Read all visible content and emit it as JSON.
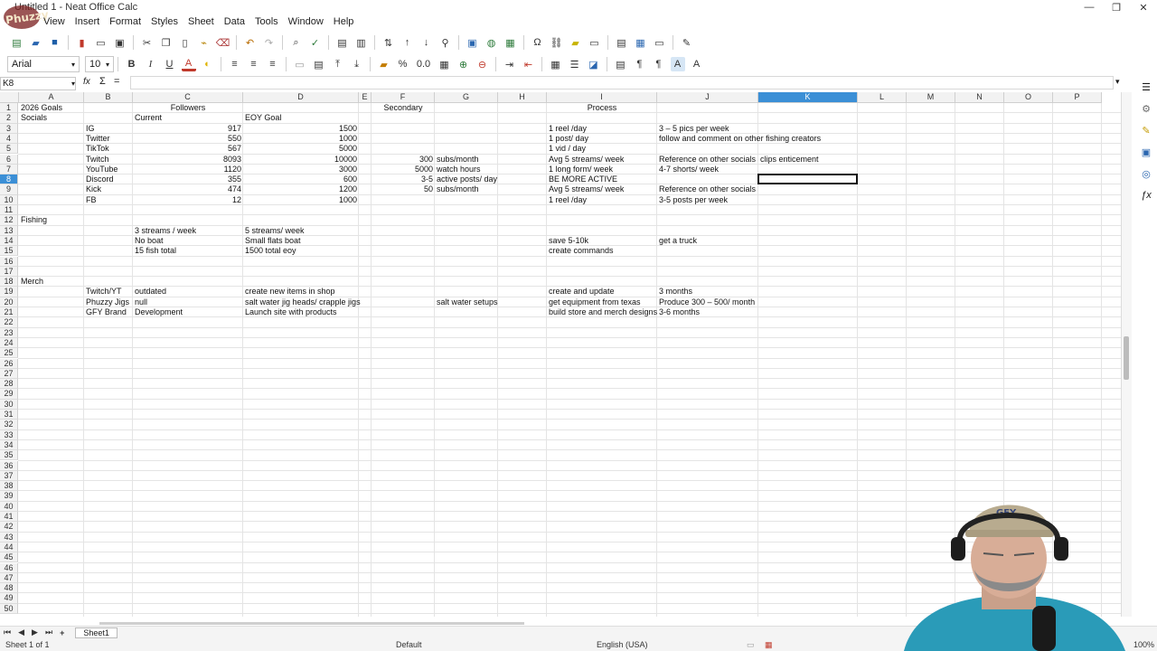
{
  "window": {
    "title": "Untitled 1 - Neat Office Calc",
    "controls": [
      "—",
      "❐",
      "✕"
    ]
  },
  "menu": [
    "View",
    "Insert",
    "Format",
    "Styles",
    "Sheet",
    "Data",
    "Tools",
    "Window",
    "Help"
  ],
  "format_toolbar": {
    "font_name": "Arial",
    "font_size": "10",
    "bold": "B",
    "italic": "I",
    "underline": "U",
    "percent": "%",
    "decimal": "0.0"
  },
  "formula_bar": {
    "name_box": "K8",
    "fx": "fx",
    "sum": "Σ",
    "equals": "="
  },
  "columns": [
    {
      "label": "A"
    },
    {
      "label": "B"
    },
    {
      "label": "C"
    },
    {
      "label": "D"
    },
    {
      "label": "E"
    },
    {
      "label": "F"
    },
    {
      "label": "G"
    },
    {
      "label": "H"
    },
    {
      "label": "I"
    },
    {
      "label": "J"
    },
    {
      "label": "K"
    },
    {
      "label": "L"
    },
    {
      "label": "M"
    },
    {
      "label": "N"
    },
    {
      "label": "O"
    },
    {
      "label": "P"
    }
  ],
  "row_count": 50,
  "active_cell": {
    "column": "K",
    "row": 8
  },
  "cells": [
    {
      "col": "A",
      "row": 1,
      "v": "2026 Goals"
    },
    {
      "col": "C",
      "row": 1,
      "v": "Followers",
      "align": "center"
    },
    {
      "col": "F",
      "row": 1,
      "v": "Secondary",
      "align": "center"
    },
    {
      "col": "I",
      "row": 1,
      "v": "Process",
      "align": "center"
    },
    {
      "col": "A",
      "row": 2,
      "v": "Socials"
    },
    {
      "col": "C",
      "row": 2,
      "v": "Current"
    },
    {
      "col": "D",
      "row": 2,
      "v": "EOY Goal"
    },
    {
      "col": "B",
      "row": 3,
      "v": "IG"
    },
    {
      "col": "C",
      "row": 3,
      "v": "917",
      "align": "right"
    },
    {
      "col": "D",
      "row": 3,
      "v": "1500",
      "align": "right"
    },
    {
      "col": "I",
      "row": 3,
      "v": "1 reel /day"
    },
    {
      "col": "J",
      "row": 3,
      "v": "3 – 5 pics per week"
    },
    {
      "col": "B",
      "row": 4,
      "v": "Twitter"
    },
    {
      "col": "C",
      "row": 4,
      "v": "550",
      "align": "right"
    },
    {
      "col": "D",
      "row": 4,
      "v": "1000",
      "align": "right"
    },
    {
      "col": "I",
      "row": 4,
      "v": "1 post/ day"
    },
    {
      "col": "J",
      "row": 4,
      "v": "follow and comment on other fishing creators"
    },
    {
      "col": "B",
      "row": 5,
      "v": "TikTok"
    },
    {
      "col": "C",
      "row": 5,
      "v": "567",
      "align": "right"
    },
    {
      "col": "D",
      "row": 5,
      "v": "5000",
      "align": "right"
    },
    {
      "col": "I",
      "row": 5,
      "v": "1 vid / day"
    },
    {
      "col": "B",
      "row": 6,
      "v": "Twitch"
    },
    {
      "col": "C",
      "row": 6,
      "v": "8093",
      "align": "right"
    },
    {
      "col": "D",
      "row": 6,
      "v": "10000",
      "align": "right"
    },
    {
      "col": "F",
      "row": 6,
      "v": "300",
      "align": "right"
    },
    {
      "col": "G",
      "row": 6,
      "v": "subs/month"
    },
    {
      "col": "I",
      "row": 6,
      "v": "Avg 5 streams/ week"
    },
    {
      "col": "J",
      "row": 6,
      "v": "Reference on other socials"
    },
    {
      "col": "K",
      "row": 6,
      "v": "clips enticement"
    },
    {
      "col": "B",
      "row": 7,
      "v": "YouTube"
    },
    {
      "col": "C",
      "row": 7,
      "v": "1120",
      "align": "right"
    },
    {
      "col": "D",
      "row": 7,
      "v": "3000",
      "align": "right"
    },
    {
      "col": "F",
      "row": 7,
      "v": "5000",
      "align": "right"
    },
    {
      "col": "G",
      "row": 7,
      "v": "watch hours"
    },
    {
      "col": "I",
      "row": 7,
      "v": "1 long form/ week"
    },
    {
      "col": "J",
      "row": 7,
      "v": "4-7 shorts/ week"
    },
    {
      "col": "B",
      "row": 8,
      "v": "Discord"
    },
    {
      "col": "C",
      "row": 8,
      "v": "355",
      "align": "right"
    },
    {
      "col": "D",
      "row": 8,
      "v": "600",
      "align": "right"
    },
    {
      "col": "F",
      "row": 8,
      "v": "3-5",
      "align": "right"
    },
    {
      "col": "G",
      "row": 8,
      "v": "active posts/ day"
    },
    {
      "col": "I",
      "row": 8,
      "v": "BE MORE ACTIVE"
    },
    {
      "col": "B",
      "row": 9,
      "v": "Kick"
    },
    {
      "col": "C",
      "row": 9,
      "v": "474",
      "align": "right"
    },
    {
      "col": "D",
      "row": 9,
      "v": "1200",
      "align": "right"
    },
    {
      "col": "F",
      "row": 9,
      "v": "50",
      "align": "right"
    },
    {
      "col": "G",
      "row": 9,
      "v": "subs/month"
    },
    {
      "col": "I",
      "row": 9,
      "v": "Avg 5 streams/ week"
    },
    {
      "col": "J",
      "row": 9,
      "v": "Reference on other socials"
    },
    {
      "col": "B",
      "row": 10,
      "v": "FB"
    },
    {
      "col": "C",
      "row": 10,
      "v": "12",
      "align": "right"
    },
    {
      "col": "D",
      "row": 10,
      "v": "1000",
      "align": "right"
    },
    {
      "col": "I",
      "row": 10,
      "v": "1 reel /day"
    },
    {
      "col": "J",
      "row": 10,
      "v": "3-5 posts per week"
    },
    {
      "col": "A",
      "row": 12,
      "v": "Fishing"
    },
    {
      "col": "C",
      "row": 13,
      "v": "3 streams / week"
    },
    {
      "col": "D",
      "row": 13,
      "v": "5 streams/ week"
    },
    {
      "col": "C",
      "row": 14,
      "v": "No boat"
    },
    {
      "col": "D",
      "row": 14,
      "v": "Small flats boat"
    },
    {
      "col": "I",
      "row": 14,
      "v": "save 5-10k"
    },
    {
      "col": "J",
      "row": 14,
      "v": "get a truck"
    },
    {
      "col": "C",
      "row": 15,
      "v": "15 fish total"
    },
    {
      "col": "D",
      "row": 15,
      "v": "1500 total eoy"
    },
    {
      "col": "I",
      "row": 15,
      "v": "create commands"
    },
    {
      "col": "A",
      "row": 18,
      "v": "Merch"
    },
    {
      "col": "B",
      "row": 19,
      "v": "Twitch/YT"
    },
    {
      "col": "C",
      "row": 19,
      "v": "outdated"
    },
    {
      "col": "D",
      "row": 19,
      "v": "create new items in shop"
    },
    {
      "col": "I",
      "row": 19,
      "v": "create and update"
    },
    {
      "col": "J",
      "row": 19,
      "v": " 3 months"
    },
    {
      "col": "B",
      "row": 20,
      "v": "Phuzzy Jigs"
    },
    {
      "col": "C",
      "row": 20,
      "v": "null"
    },
    {
      "col": "D",
      "row": 20,
      "v": "salt water jig heads/ crapple jigs"
    },
    {
      "col": "G",
      "row": 20,
      "v": "salt water setups"
    },
    {
      "col": "I",
      "row": 20,
      "v": "get equipment from texas"
    },
    {
      "col": "J",
      "row": 20,
      "v": "Produce 300 – 500/ month"
    },
    {
      "col": "B",
      "row": 21,
      "v": "GFY Brand"
    },
    {
      "col": "C",
      "row": 21,
      "v": "Development"
    },
    {
      "col": "D",
      "row": 21,
      "v": "Launch site with products"
    },
    {
      "col": "I",
      "row": 21,
      "v": "build store and merch designs"
    },
    {
      "col": "J",
      "row": 21,
      "v": "3-6 months"
    }
  ],
  "sheet_tab": "Sheet1",
  "status": {
    "sheet": "Sheet 1 of 1",
    "style": "Default",
    "language": "English (USA)",
    "zoom": "100%"
  },
  "logo_text": "Phuzzy",
  "webcam_cap_text": "GFY"
}
